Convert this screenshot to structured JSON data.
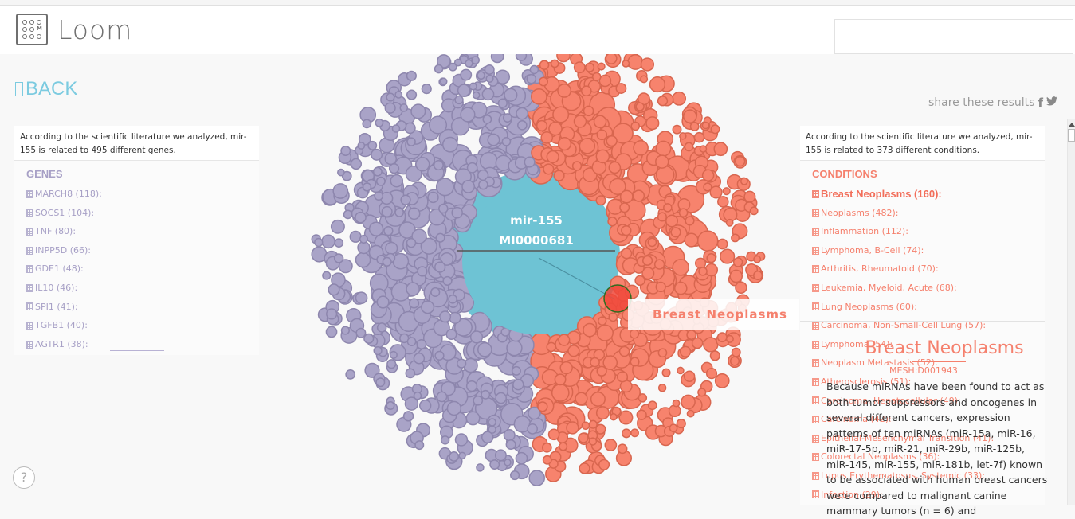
{
  "app": {
    "name": "Loom",
    "logo_letter": "M"
  },
  "nav": {
    "back_label": "BACK"
  },
  "share": {
    "label": "share these results",
    "facebook_icon": "f",
    "twitter_icon": "🐦"
  },
  "genes_panel": {
    "intro": "According to the scientific literature we analyzed, mir-155 is related to 495 different genes.",
    "title": "GENES",
    "items": [
      "MARCH8 (118):",
      "SOCS1 (104):",
      "TNF (80):",
      "INPP5D (66):",
      "GDE1 (48):",
      "IL10 (46):",
      "SPI1 (41):",
      "TGFB1 (40):",
      "AGTR1 (38):"
    ]
  },
  "conditions_panel": {
    "intro": "According to the scientific literature we analyzed, mir-155 is related to 373 different conditions.",
    "title": "CONDITIONS",
    "selected": "Breast Neoplasms (160):",
    "items": [
      "Neoplasms (482):",
      "Inflammation (112):",
      "Lymphoma, B-Cell (74):",
      "Arthritis, Rheumatoid (70):",
      "Leukemia, Myeloid, Acute (68):",
      "Lung Neoplasms (60):",
      "Carcinoma, Non-Small-Cell Lung (57):",
      "Lymphoma (54):",
      "Neoplasm Metastasis (52):",
      "Atherosclerosis (51):",
      "Carcinoma, Hepatocellular (49):",
      "Carcinoma (42):",
      "Epithelial-Mesenchymal Transition (41):",
      "Colorectal Neoplasms (36):",
      "Lupus Erythematosus, Systemic (33):",
      "Infection (29):"
    ]
  },
  "visualization": {
    "center_name": "mir-155",
    "center_id": "MI0000681",
    "hover_label": "Breast Neoplasms",
    "colors": {
      "genes": "#a9a3c7",
      "genes_stroke": "#8d86ad",
      "conditions": "#f7836d",
      "conditions_stroke": "#d8664f",
      "center": "#6ec3d4",
      "highlight": "#f0483a"
    }
  },
  "detail": {
    "title": "Breast Neoplasms",
    "mesh_id": "MESH:D001943",
    "abstract": "Because miRNAs have been found to act as both tumor suppressors and oncogenes in several different cancers, expression patterns of ten miRNAs (miR-15a, miR-16, miR-17-5p, miR-21, miR-29b, miR-125b, miR-145, miR-155, miR-181b, let-7f) known to be associated with human breast cancers were compared to malignant canine mammary tumors (n = 6) and"
  },
  "help": {
    "label": "?"
  }
}
